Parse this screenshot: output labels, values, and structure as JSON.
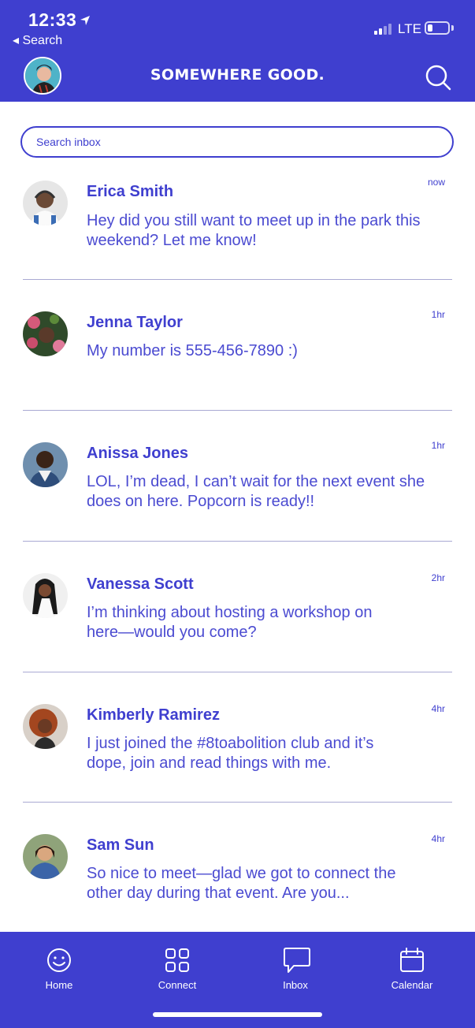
{
  "status_bar": {
    "time": "12:33",
    "back_label": "◂ Search",
    "network": "LTE",
    "battery_level": 0.25
  },
  "header": {
    "brand": "SOMEWHERE GOOD."
  },
  "search": {
    "placeholder": "Search inbox"
  },
  "messages": [
    {
      "name": "Erica Smith",
      "time": "now",
      "preview": "Hey did you still want to meet up in the park this weekend? Let me know!"
    },
    {
      "name": "Jenna Taylor",
      "time": "1hr",
      "preview": "My number is 555-456-7890 :)"
    },
    {
      "name": "Anissa Jones",
      "time": "1hr",
      "preview": "LOL, I’m dead, I can’t wait for the next event she does on here. Popcorn is ready!!"
    },
    {
      "name": "Vanessa Scott",
      "time": "2hr",
      "preview": "I’m thinking about hosting a workshop on here—would you come?"
    },
    {
      "name": "Kimberly Ramirez",
      "time": "4hr",
      "preview": "I just joined the #8toabolition club and it’s dope, join and read things with me."
    },
    {
      "name": "Sam Sun",
      "time": "4hr",
      "preview": "So nice to meet—glad we got to connect the other day during that event. Are you..."
    }
  ],
  "tabs": [
    {
      "label": "Home",
      "icon": "smiley-icon"
    },
    {
      "label": "Connect",
      "icon": "grid-icon"
    },
    {
      "label": "Inbox",
      "icon": "chat-bubble-icon"
    },
    {
      "label": "Calendar",
      "icon": "calendar-icon"
    }
  ],
  "colors": {
    "brand": "#3f3fcf",
    "text_on_brand": "#ffffff",
    "divider": "#a9a9d3"
  }
}
